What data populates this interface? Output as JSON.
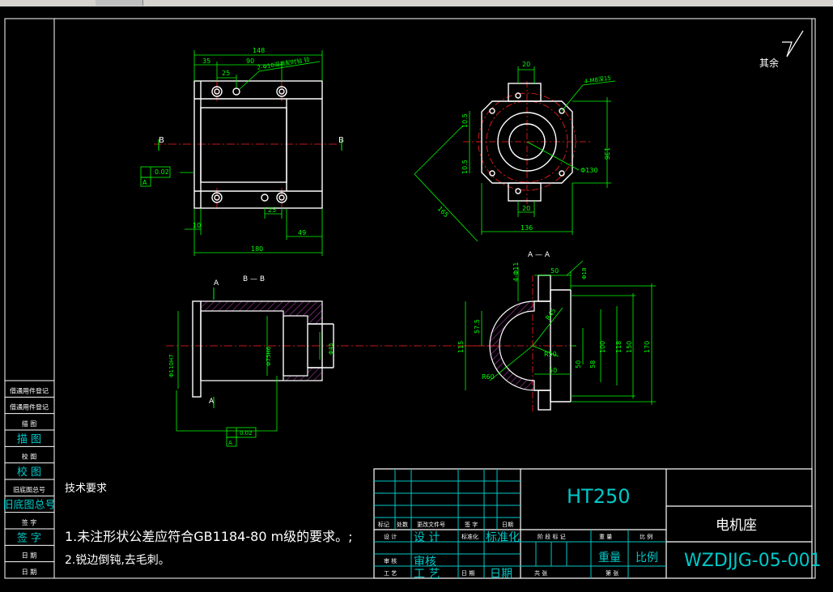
{
  "remainder_label": "其余",
  "views": {
    "front": {
      "dims": {
        "overall_top": "148",
        "offset_left": "35",
        "spacing": "90",
        "hole_spacing": "25",
        "hole_note": "2-Φ10深装配时钻 铰",
        "bottom_hole": "25",
        "left_edge": "10",
        "right_offset": "49",
        "overall_bottom": "180"
      },
      "section_mark_left": "B",
      "section_mark_right": "B",
      "tolerance_value": "0.02",
      "datum": "A"
    },
    "side": {
      "dims": {
        "top_width": "20",
        "hole_note": "4-M8深15",
        "upper_half": "10.5",
        "lower_half": "10.5",
        "height": "136",
        "diameter": "Φ130",
        "bottom_width": "20",
        "diagonal": "165",
        "width": "136"
      }
    },
    "section_b": {
      "title": "B — B",
      "cut_mark": "A",
      "dims": {
        "bore_large": "Φ110H7",
        "bore_mid": "Φ75H6",
        "bore_small": "Φ45"
      },
      "tolerance_value": "0.02",
      "datum": "A"
    },
    "section_a": {
      "title": "A — A",
      "dims": {
        "hole": "4-Φ11",
        "width_top": "50",
        "cbore": "Φ18",
        "r_inner": "R45",
        "r_mid": "R50",
        "r_outer": "R60",
        "h_575": "57.5",
        "h_115": "115",
        "width_mid": "50",
        "h_50": "50",
        "h_58": "58",
        "h_100": "100",
        "h_118": "118",
        "h_150": "150",
        "h_170": "170"
      }
    }
  },
  "left_stamp": [
    "借通用件登记",
    "借通用件登记",
    "描  图",
    "描  图",
    "校  图",
    "校  图",
    "旧底图总号",
    "旧底图总号",
    "签  字",
    "签  字",
    "日  期",
    "日  期"
  ],
  "tech_req": {
    "title": "技术要求",
    "line1": "1.未注形状公差应符合GB1184-80 m级的要求。;",
    "line2": "2.锐边倒钝,去毛刺。"
  },
  "title_block": {
    "material": "HT250",
    "part_name": "电机座",
    "drawing_number": "WZDJJG-05-001",
    "row_headers": [
      "标记",
      "处数",
      "更改文件号",
      "签 字",
      "日期"
    ],
    "design": "设 计",
    "design_small": "设 计",
    "standard": "标准化",
    "standard_small": "标准化",
    "review": "审核",
    "review_small": "审 核",
    "craft": "工 艺",
    "craft_small": "工 艺",
    "date": "日期",
    "date_small": "日 期",
    "stage_mark": "阶 段 标 记",
    "weight_small": "重 量",
    "ratio_small": "比 例",
    "weight": "重量",
    "ratio": "比例",
    "sheets_total": "共  张",
    "sheet_no": "第  张"
  }
}
